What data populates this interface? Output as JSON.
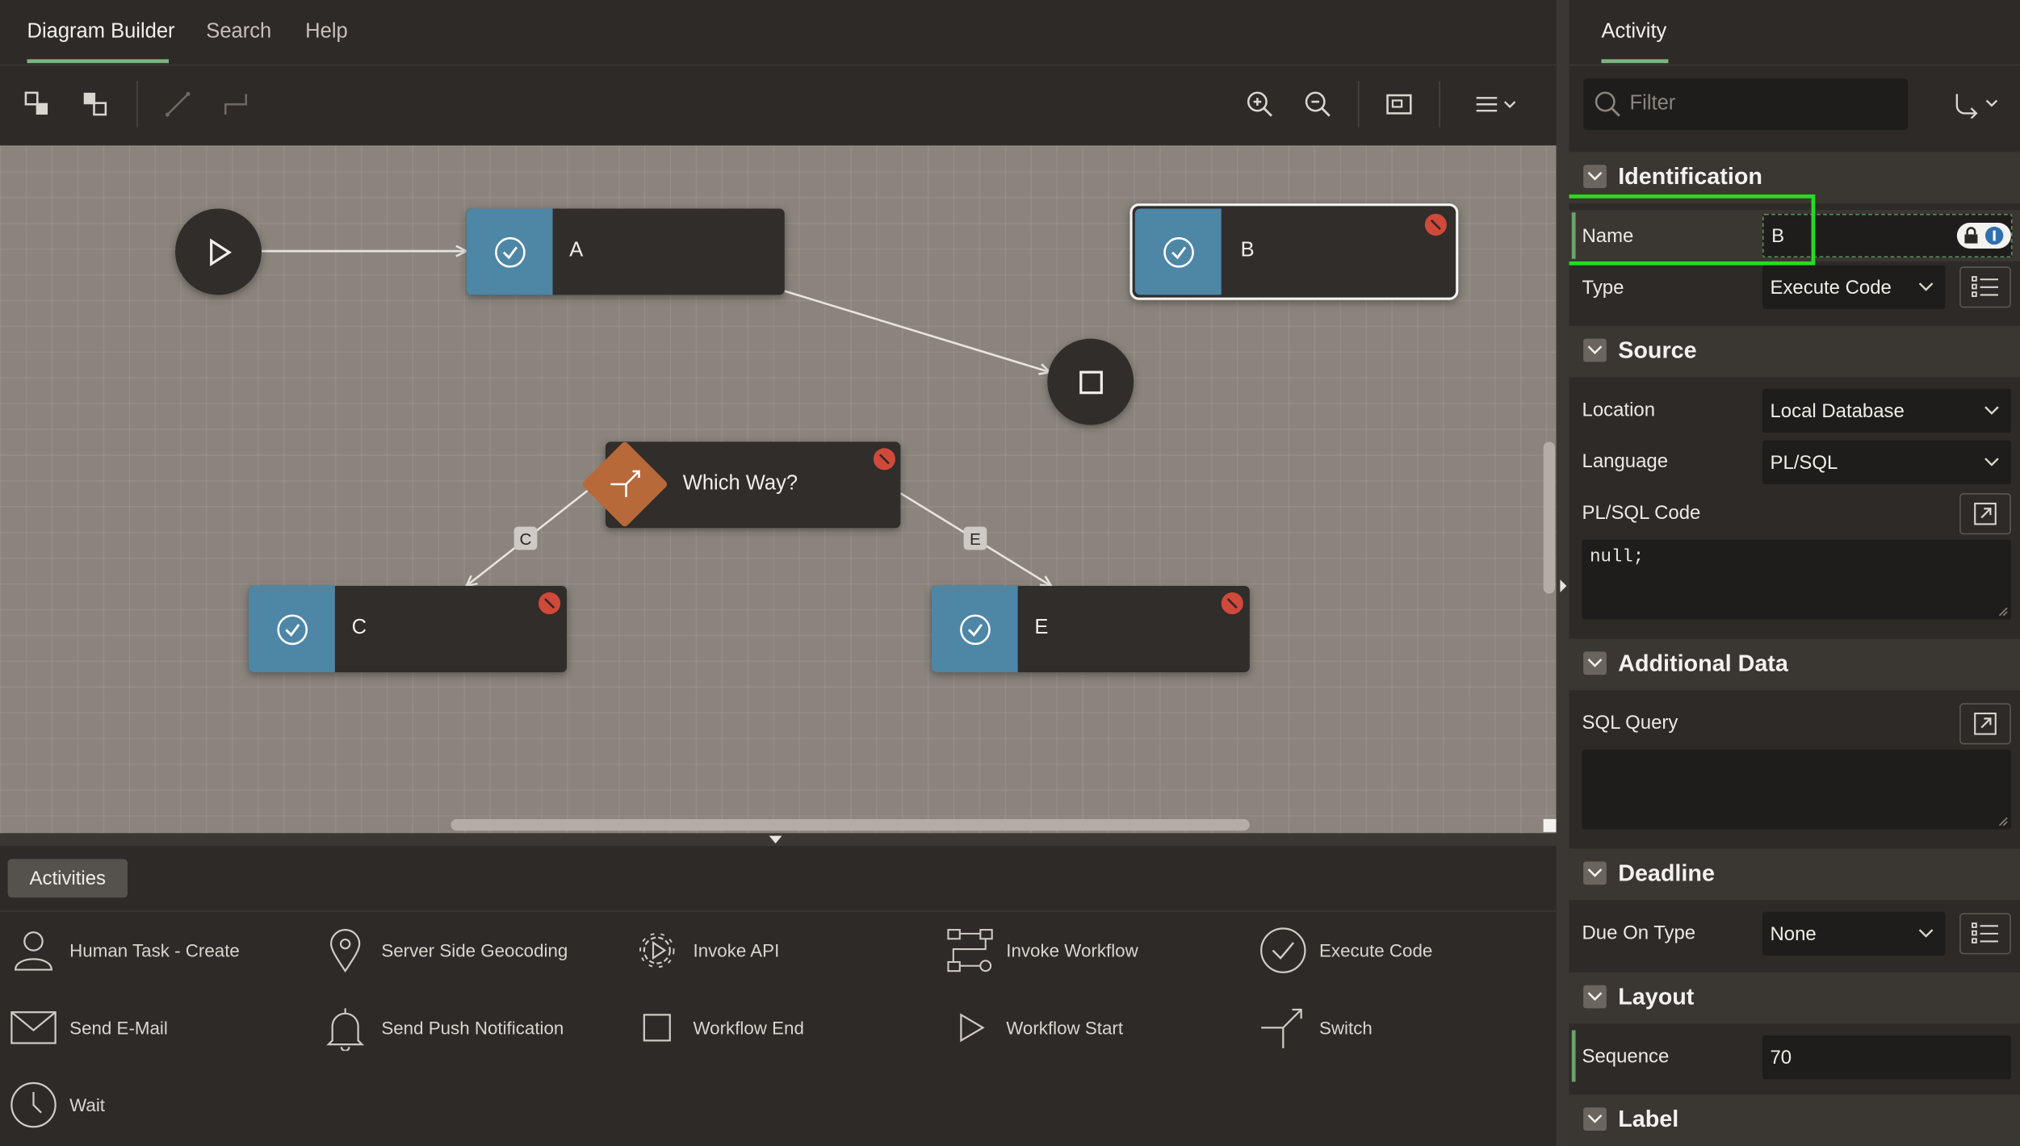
{
  "left_tabs": [
    {
      "label": "Diagram Builder",
      "active": true
    },
    {
      "label": "Search",
      "active": false
    },
    {
      "label": "Help",
      "active": false
    }
  ],
  "toolbar": {
    "icons": [
      "expand-icon",
      "collapse-icon",
      "straight-connector-icon",
      "elbow-connector-icon",
      "zoom-in-icon",
      "zoom-out-icon",
      "fit-icon",
      "menu-icon"
    ]
  },
  "diagram": {
    "nodes": {
      "start": {
        "type": "workflow-start"
      },
      "a": {
        "label": "A",
        "type": "execute-code",
        "error": false
      },
      "b": {
        "label": "B",
        "type": "execute-code",
        "error": true,
        "selected": true
      },
      "end": {
        "type": "workflow-end"
      },
      "switch": {
        "label": "Which Way?",
        "type": "switch",
        "error": true
      },
      "c": {
        "label": "C",
        "type": "execute-code",
        "error": true
      },
      "e": {
        "label": "E",
        "type": "execute-code",
        "error": true
      }
    },
    "edge_labels": {
      "c": "C",
      "e": "E"
    },
    "colors": {
      "canvas": "#8a847c",
      "activity": "#4e86a6",
      "switch": "#b8693a",
      "error": "#d0493a"
    }
  },
  "palette": {
    "tab_label": "Activities",
    "items": [
      {
        "label": "Human Task - Create",
        "icon": "person-icon"
      },
      {
        "label": "Server Side Geocoding",
        "icon": "map-pin-icon"
      },
      {
        "label": "Invoke API",
        "icon": "gear-icon"
      },
      {
        "label": "Invoke Workflow",
        "icon": "workflow-icon"
      },
      {
        "label": "Execute Code",
        "icon": "check-circle-icon"
      },
      {
        "label": "Send E-Mail",
        "icon": "envelope-icon"
      },
      {
        "label": "Send Push Notification",
        "icon": "bell-icon"
      },
      {
        "label": "Workflow End",
        "icon": "square-icon"
      },
      {
        "label": "Workflow Start",
        "icon": "play-icon"
      },
      {
        "label": "Switch",
        "icon": "switch-icon"
      },
      {
        "label": "Wait",
        "icon": "clock-icon"
      }
    ]
  },
  "right_panel": {
    "tab_label": "Activity",
    "filter": {
      "placeholder": "Filter",
      "value": ""
    },
    "sections": {
      "identification": {
        "title": "Identification",
        "name_label": "Name",
        "name_value": "B",
        "type_label": "Type",
        "type_value": "Execute Code"
      },
      "source": {
        "title": "Source",
        "location_label": "Location",
        "location_value": "Local Database",
        "language_label": "Language",
        "language_value": "PL/SQL",
        "code_label": "PL/SQL Code",
        "code_value": "null;"
      },
      "additional": {
        "title": "Additional Data",
        "sql_label": "SQL Query",
        "sql_value": ""
      },
      "deadline": {
        "title": "Deadline",
        "due_label": "Due On Type",
        "due_value": "None"
      },
      "layout": {
        "title": "Layout",
        "sequence_label": "Sequence",
        "sequence_value": "70"
      },
      "label": {
        "title": "Label"
      }
    },
    "highlight_color": "#22dd22"
  }
}
